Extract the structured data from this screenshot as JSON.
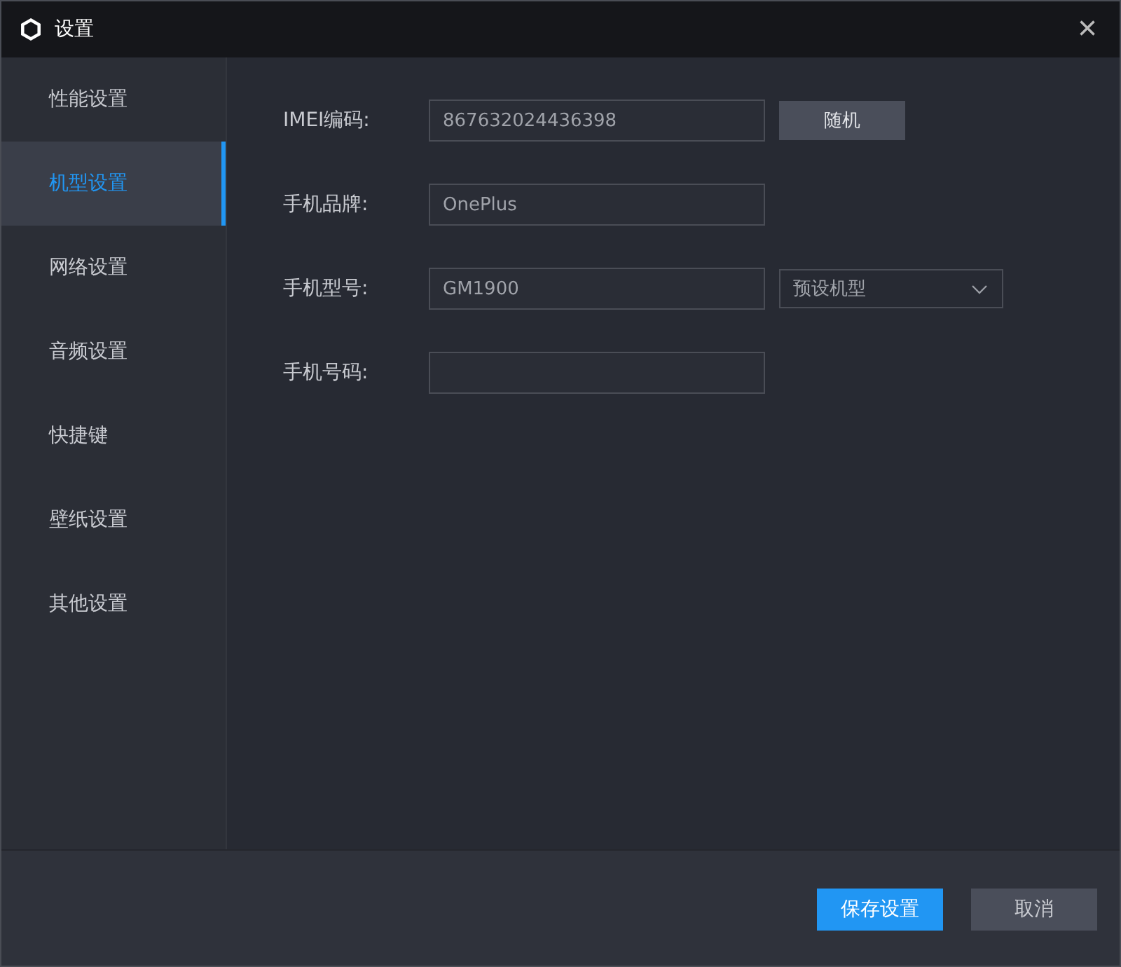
{
  "window": {
    "title": "设置",
    "close": "×"
  },
  "sidebar": {
    "items": [
      {
        "label": "性能设置",
        "selected": false
      },
      {
        "label": "机型设置",
        "selected": true
      },
      {
        "label": "网络设置",
        "selected": false
      },
      {
        "label": "音频设置",
        "selected": false
      },
      {
        "label": "快捷键",
        "selected": false
      },
      {
        "label": "壁纸设置",
        "selected": false
      },
      {
        "label": "其他设置",
        "selected": false
      }
    ]
  },
  "fields": [
    {
      "kind": "button",
      "label": "IMEI编码:",
      "value": "867632024436398",
      "action": "随机"
    },
    {
      "kind": "plain",
      "label": "手机品牌:",
      "value": "OnePlus"
    },
    {
      "kind": "select",
      "label": "手机型号:",
      "value": "GM1900",
      "select": "预设机型"
    },
    {
      "kind": "plain",
      "label": "手机号码:"
    }
  ],
  "footer": {
    "save": "保存设置",
    "cancel": "取消"
  }
}
